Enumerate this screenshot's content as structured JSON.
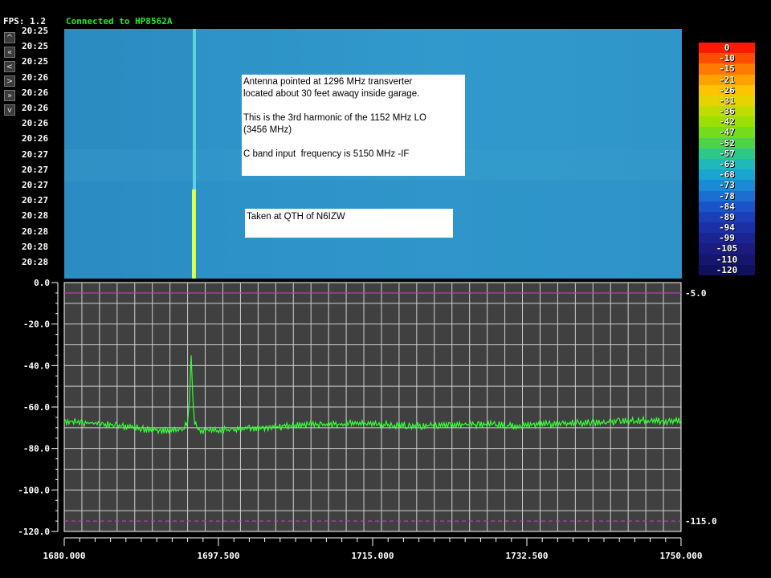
{
  "header": {
    "fps_text": "FPS: 1.2",
    "status_text": "Connected to HP8562A"
  },
  "nav_buttons": [
    "^",
    "«",
    "<",
    ">",
    "»",
    "v"
  ],
  "waterfall": {
    "time_labels": [
      "20:25",
      "20:25",
      "20:25",
      "20:26",
      "20:26",
      "20:26",
      "20:26",
      "20:26",
      "20:27",
      "20:27",
      "20:27",
      "20:27",
      "20:28",
      "20:28",
      "20:28",
      "20:28"
    ]
  },
  "notes": [
    {
      "lines": [
        "Antenna pointed at 1296 MHz transverter",
        "located about 30 feet awaqy inside garage.",
        "",
        "This is the 3rd harmonic of the 1152 MHz LO",
        "(3456 MHz)",
        "",
        "C band input  frequency is 5150 MHz -IF"
      ]
    },
    {
      "lines": [
        "Taken at QTH of N6IZW"
      ]
    }
  ],
  "colorbar": {
    "labels": [
      "0",
      "-10",
      "-15",
      "-21",
      "-26",
      "-31",
      "-36",
      "-42",
      "-47",
      "-52",
      "-57",
      "-63",
      "-68",
      "-73",
      "-78",
      "-84",
      "-89",
      "-94",
      "-99",
      "-105",
      "-110",
      "-120"
    ],
    "colors": [
      "#ff1a00",
      "#ff4d00",
      "#ff7a00",
      "#ffa200",
      "#ffc400",
      "#e6d400",
      "#c0dc00",
      "#9be000",
      "#74dc1a",
      "#4cd34a",
      "#2ec78a",
      "#20b9b9",
      "#1aa4d0",
      "#1a8ad4",
      "#1a6fd0",
      "#1a54c8",
      "#1a3fb8",
      "#1a30a4",
      "#1a2592",
      "#1a1c80",
      "#16166e",
      "#10105c"
    ]
  },
  "chart_data": {
    "type": "line",
    "xlim": [
      1680.0,
      1750.0
    ],
    "ylim": [
      -120.0,
      0.0
    ],
    "x_tick_labels": [
      "1680.000",
      "1697.500",
      "1715.000",
      "1732.500",
      "1750.000"
    ],
    "x_ticks": [
      1680.0,
      1697.5,
      1715.0,
      1732.5,
      1750.0
    ],
    "y_tick_labels": [
      "0.0",
      "-20.0",
      "-40.0",
      "-60.0",
      "-80.0",
      "-100.0",
      "-120.0"
    ],
    "y_ticks": [
      0,
      -20,
      -40,
      -60,
      -80,
      -100,
      -120
    ],
    "reference_lines": [
      {
        "value": -5.0,
        "label": "-5.0",
        "style": "solid",
        "color": "#c040c0"
      },
      {
        "value": -115.0,
        "label": "-115.0",
        "style": "dashed",
        "color": "#c040c0"
      }
    ],
    "grid": true,
    "grid_color": "#d0d0d0",
    "background_color": "#404040",
    "trace_color": "#33ff33",
    "series": [
      {
        "x": [
          1680.0,
          1682.0,
          1684.0,
          1686.0,
          1688.0,
          1690.0,
          1692.0,
          1693.5,
          1694.0,
          1694.2,
          1694.4,
          1694.6,
          1694.8,
          1695.2,
          1697.0,
          1699.0,
          1701.0,
          1703.0,
          1705.0,
          1707.0,
          1710.0,
          1713.0,
          1716.0,
          1719.0,
          1722.0,
          1725.0,
          1728.0,
          1731.0,
          1734.0,
          1737.0,
          1740.0,
          1743.0,
          1746.0,
          1748.0,
          1750.0
        ],
        "y": [
          -66.5,
          -67.5,
          -68.0,
          -69.0,
          -70.0,
          -71.0,
          -71.5,
          -71.0,
          -66.0,
          -56.0,
          -35.0,
          -56.0,
          -67.0,
          -71.0,
          -71.5,
          -71.0,
          -70.5,
          -70.0,
          -69.5,
          -68.5,
          -68.5,
          -68.0,
          -68.5,
          -69.0,
          -69.0,
          -68.5,
          -68.5,
          -69.0,
          -68.5,
          -68.0,
          -67.5,
          -67.0,
          -66.5,
          -67.0,
          -66.5
        ]
      }
    ]
  }
}
